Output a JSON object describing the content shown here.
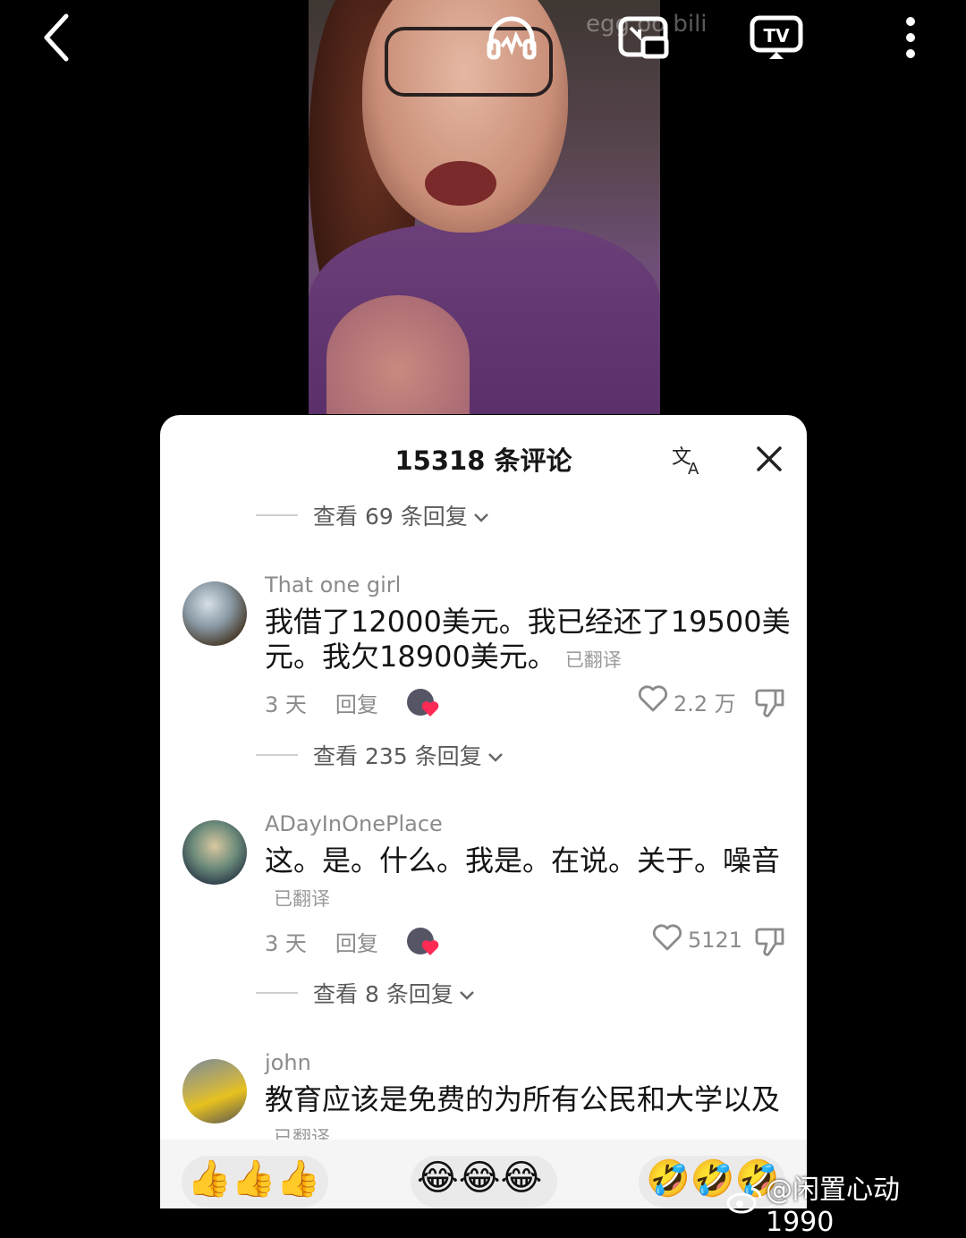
{
  "topbar": {
    "watermark": "egg  oo  bili",
    "icons": [
      "back-icon",
      "headphones-icon",
      "pip-icon",
      "tv-cast-icon",
      "more-icon"
    ]
  },
  "panel": {
    "title": "15318 条评论",
    "replies_1": "查看 69 条回复",
    "replies_2": "查看 235 条回复",
    "replies_3": "查看 8 条回复",
    "comments": [
      {
        "user": "That one girl",
        "text": "我借了12000美元。我已经还了19500美元。我欠18900美元。",
        "tag": "已翻译",
        "time": "3 天",
        "reply": "回复",
        "likes": "2.2 万"
      },
      {
        "user": "ADayInOnePlace",
        "text": "这。是。什么。我是。在说。关于。噪音",
        "tag": "已翻译",
        "time": "3 天",
        "reply": "回复",
        "likes": "5121"
      },
      {
        "user": "john",
        "text": "教育应该是免费的为所有公民和大学以及",
        "tag": "已翻译"
      }
    ],
    "emoji_groups": [
      "👍👍👍",
      "😂😂😂",
      "🤣🤣🤣"
    ]
  },
  "watermark_weibo": "@闲置心动1990",
  "colors": {
    "background": "#000000",
    "panel": "#ffffff",
    "like_red": "#ff2b55"
  }
}
